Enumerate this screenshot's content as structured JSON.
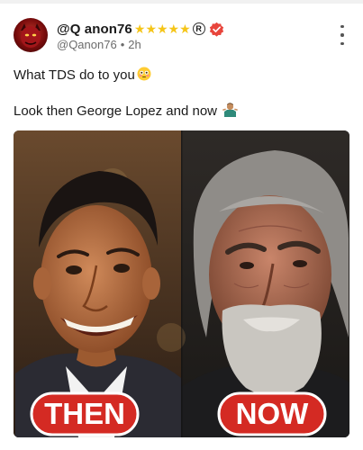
{
  "post": {
    "author": {
      "display_name": "@Q anon76",
      "stars": "★★★★★",
      "registered": "R",
      "handle": "@Qanon76",
      "separator": "•",
      "time": "2h"
    },
    "text_line1": "What TDS do to you",
    "text_line2": "Look then George Lopez and now",
    "image": {
      "left_label": "THEN",
      "right_label": "NOW"
    }
  },
  "icons": {
    "avatar": "red-demon-avatar",
    "verified": "verified-badge-icon",
    "more": "more-vertical-icon",
    "emoji1": "flushed-face-emoji",
    "emoji2": "person-shrugging-emoji"
  },
  "colors": {
    "accent_red": "#e8453c",
    "label_red": "#d42a23",
    "star_gold": "#f5c518",
    "muted_text": "#6b6b6b"
  }
}
